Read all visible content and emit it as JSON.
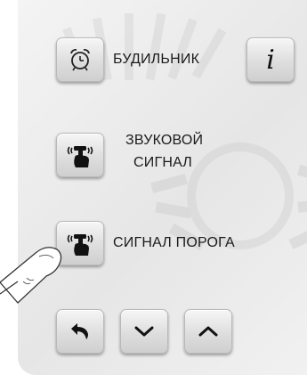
{
  "menu": {
    "alarm_label": "БУДИЛЬНИК",
    "sound_signal_label_line1": "ЗВУКОВОЙ",
    "sound_signal_label_line2": "СИГНАЛ",
    "threshold_signal_label": "СИГНАЛ ПОРОГА",
    "info_key_label": "i"
  },
  "icons": {
    "alarm": "alarm-clock-icon",
    "sound_signal": "hand-tap-sound-icon",
    "threshold_signal": "hand-tap-sound-icon",
    "info": "info-icon",
    "back": "back-arrow-icon",
    "down": "chevron-down-icon",
    "up": "chevron-up-icon",
    "finger": "pointing-finger-illustration"
  },
  "colors": {
    "key_face_top": "#f6f6f6",
    "key_face_bottom": "#cfcfcf",
    "icon_dark": "#111111",
    "background": "#e8e8e8"
  }
}
